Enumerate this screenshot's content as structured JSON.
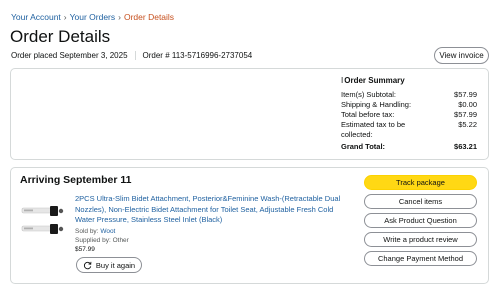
{
  "breadcrumb": {
    "items": [
      "Your Account",
      "Your Orders",
      "Order Details"
    ],
    "separator": "›"
  },
  "page": {
    "title": "Order Details",
    "order_placed": "Order placed September 3, 2025",
    "order_number": "Order # 113-5716996-2737054",
    "view_invoice": "View invoice"
  },
  "summary": {
    "title": "Order Summary",
    "rows": [
      {
        "label": "Item(s) Subtotal:",
        "value": "$57.99"
      },
      {
        "label": "Shipping & Handling:",
        "value": "$0.00"
      },
      {
        "label": "Total before tax:",
        "value": "$57.99"
      },
      {
        "label": "Estimated tax to be collected:",
        "value": "$5.22"
      }
    ],
    "grand_total": {
      "label": "Grand Total:",
      "value": "$63.21"
    }
  },
  "shipment": {
    "heading": "Arriving September 11",
    "item": {
      "title": "2PCS Ultra-Slim Bidet Attachment, Posterior&Feminine Wash-(Retractable Dual Nozzles), Non-Electric Bidet Attachment for Toilet Seat, Adjustable Fresh Cold Water Pressure, Stainless Steel Inlet (Black)",
      "sold_by_label": "Sold by:",
      "sold_by": "Woot",
      "supplied_by": "Supplied by: Other",
      "price": "$57.99",
      "buy_again": "Buy it again"
    },
    "actions": [
      "Track package",
      "Cancel items",
      "Ask Product Question",
      "Write a product review",
      "Change Payment Method"
    ]
  },
  "colors": {
    "link": "#2162a1",
    "active_crumb": "#c7511f",
    "primary_button": "#ffd814",
    "border": "#d5d9d9"
  },
  "icons": {
    "cursor": "text-cursor-icon",
    "buy_again": "refresh-icon"
  }
}
